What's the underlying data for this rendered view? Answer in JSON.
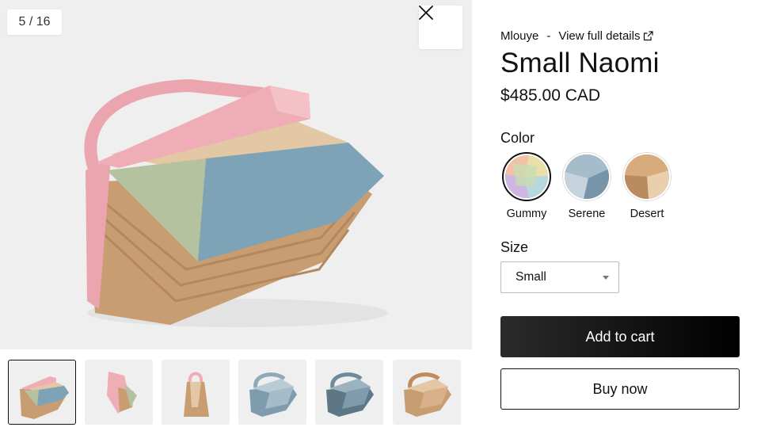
{
  "gallery": {
    "counter": "5 / 16",
    "close_icon": "close-icon",
    "thumbnails": [
      {
        "name": "thumbnail-1",
        "selected": true,
        "view": "front-angle"
      },
      {
        "name": "thumbnail-2",
        "selected": false,
        "view": "side-open"
      },
      {
        "name": "thumbnail-3",
        "selected": false,
        "view": "side-profile"
      },
      {
        "name": "thumbnail-4",
        "selected": false,
        "view": "blue-front"
      },
      {
        "name": "thumbnail-5",
        "selected": false,
        "view": "blue-angle"
      },
      {
        "name": "thumbnail-6",
        "selected": false,
        "view": "tan-front"
      }
    ]
  },
  "product": {
    "brand": "Mlouye",
    "separator": "-",
    "details_link": "View full details",
    "details_icon": "external-link-icon",
    "title": "Small Naomi",
    "price": "$485.00 CAD",
    "color_label": "Color",
    "colors": [
      {
        "name": "Gummy",
        "selected": true
      },
      {
        "name": "Serene",
        "selected": false
      },
      {
        "name": "Desert",
        "selected": false
      }
    ],
    "size_label": "Size",
    "size_selected": "Small",
    "add_to_cart": "Add to cart",
    "buy_now": "Buy now"
  },
  "colors": {
    "pink": "#efadb5",
    "beige": "#e4c8a6",
    "tan": "#c99d72",
    "sage": "#b5c29f",
    "blue": "#7ea3b7",
    "button_dark": "#111111"
  }
}
